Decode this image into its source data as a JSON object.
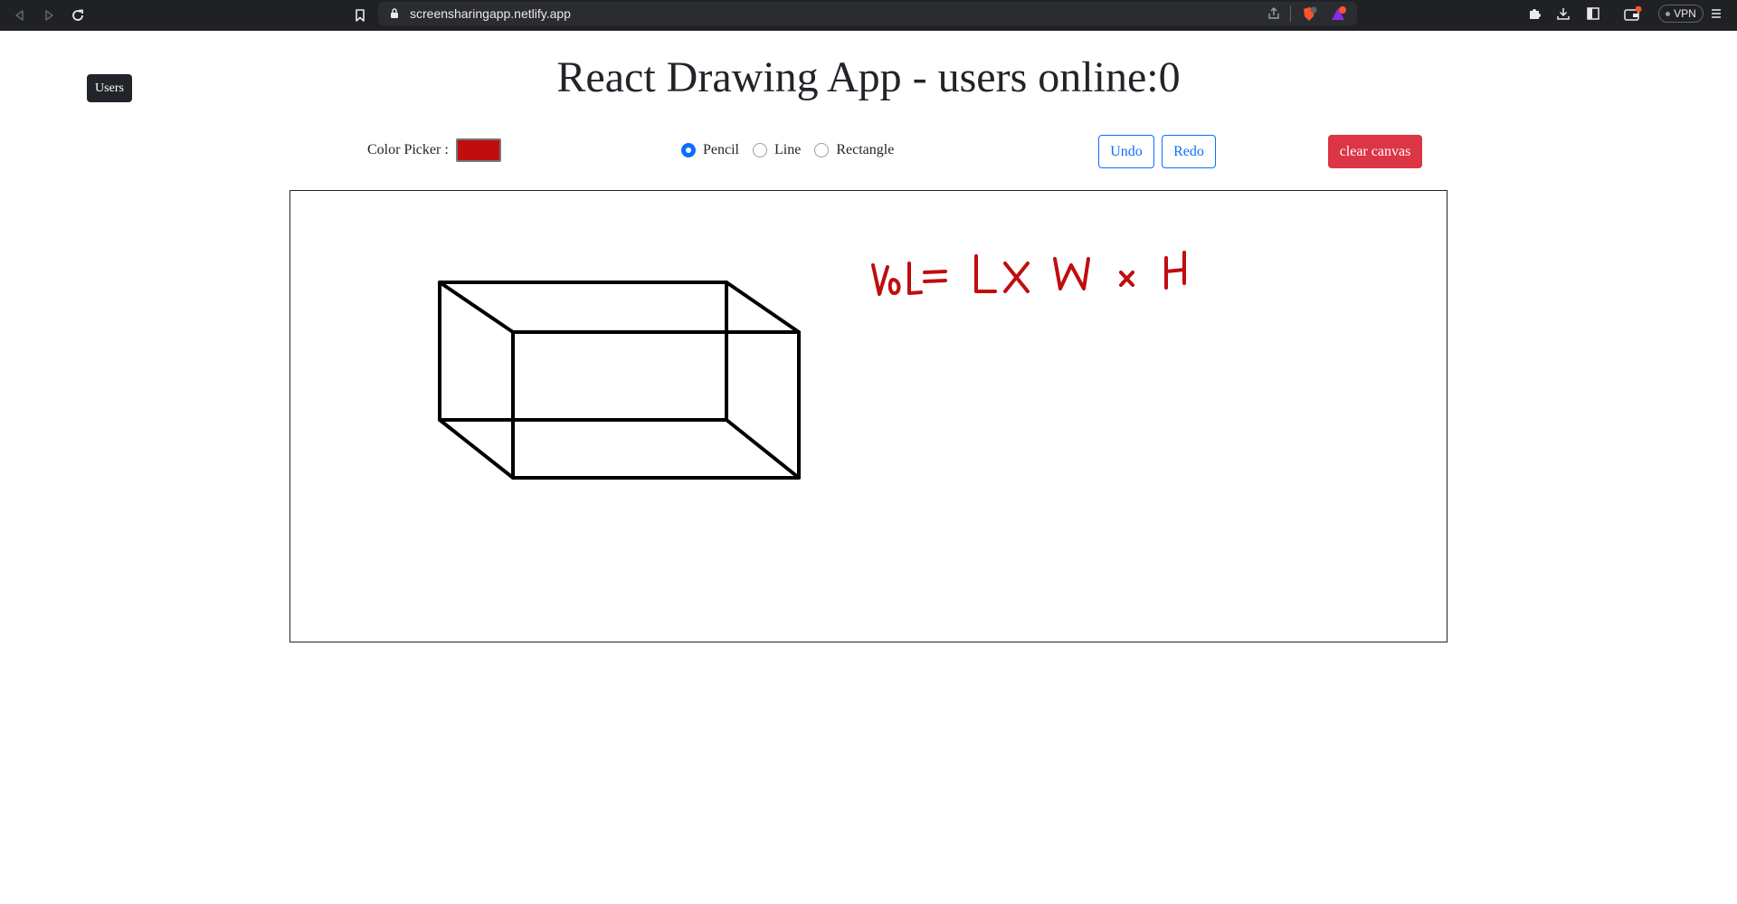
{
  "browser": {
    "url": "screensharingapp.netlify.app",
    "vpn_label": "VPN",
    "brave_badge": "1",
    "alert_badge": "1"
  },
  "page": {
    "users_button": "Users",
    "title": "React Drawing App - users online:0"
  },
  "toolbar": {
    "color_picker_label": "Color Picker :",
    "selected_color": "#c00d0d",
    "tools": [
      {
        "label": "Pencil",
        "checked": true
      },
      {
        "label": "Line",
        "checked": false
      },
      {
        "label": "Rectangle",
        "checked": false
      }
    ],
    "undo_label": "Undo",
    "redo_label": "Redo",
    "clear_label": "clear canvas"
  },
  "colors": {
    "primary": "#0d6efd",
    "danger": "#dc3545",
    "dark": "#212529",
    "stroke_black": "#000000",
    "stroke_red": "#c00d0d"
  },
  "canvas": {
    "handwriting": "VoL= L X W x H"
  }
}
